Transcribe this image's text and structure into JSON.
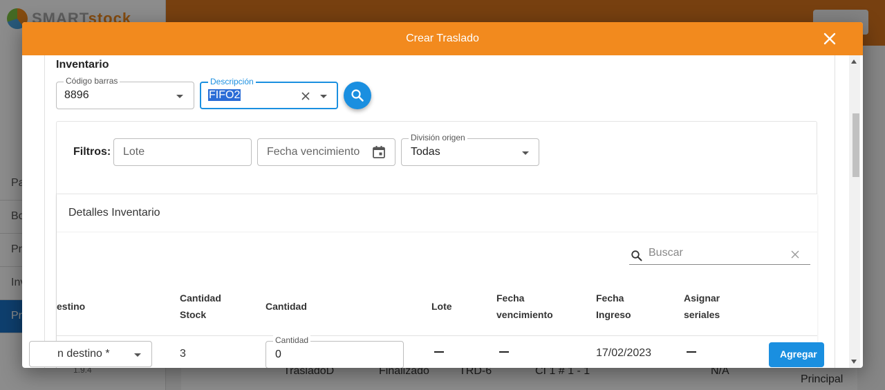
{
  "background": {
    "logo_prefix": "SMART",
    "logo_suffix": "stock",
    "menu_items": [
      "Pa",
      "Bo",
      "Pr",
      "Inv",
      "Pr"
    ],
    "version": "1.9.4",
    "row": {
      "name": "TrasladoD",
      "status": "Finalizado",
      "code": "TRD-6",
      "location": "CI 1 # 1 - 1",
      "na": "N/A",
      "division": "Principal"
    }
  },
  "modal": {
    "title": "Crear Traslado",
    "section_title": "Inventario",
    "barcode": {
      "label": "Código barras",
      "value": "8896"
    },
    "description": {
      "label": "Descripción",
      "value": "FIFO2"
    },
    "filters": {
      "label": "Filtros:",
      "lote_placeholder": "Lote",
      "fecha_placeholder": "Fecha vencimiento",
      "division": {
        "label": "División origen",
        "value": "Todas"
      }
    },
    "details": {
      "title": "Detalles Inventario",
      "search_placeholder": "Buscar",
      "columns": {
        "destino": "estino",
        "cantidad_stock_1": "Cantidad",
        "cantidad_stock_2": "Stock",
        "cantidad": "Cantidad",
        "lote": "Lote",
        "fecha_venc_1": "Fecha",
        "fecha_venc_2": "vencimiento",
        "fecha_ing_1": "Fecha",
        "fecha_ing_2": "Ingreso",
        "asignar_1": "Asignar",
        "asignar_2": "seriales"
      },
      "row": {
        "destino_value": "n destino *",
        "stock": "3",
        "cantidad_label": "Cantidad",
        "cantidad_value": "0",
        "fecha_ingreso": "17/02/2023",
        "add_label": "Agregar"
      }
    }
  },
  "colors": {
    "header": "#f28a1e",
    "primary": "#1a8fe0"
  }
}
